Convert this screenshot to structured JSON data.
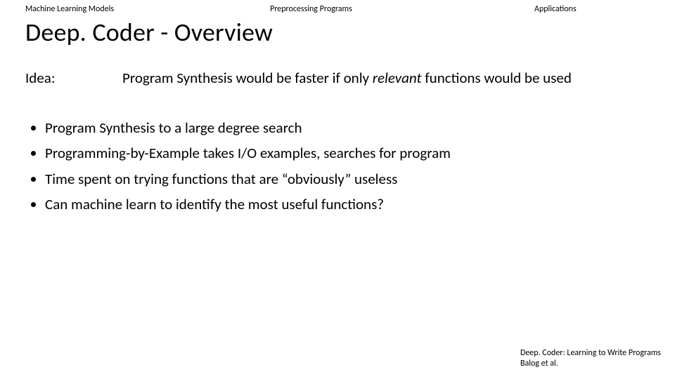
{
  "tabs": {
    "left": "Machine Learning Models",
    "mid": "Preprocessing Programs",
    "right": "Applications"
  },
  "title": "Deep. Coder - Overview",
  "idea": {
    "label": "Idea:",
    "pre": "Program Synthesis would be faster if only ",
    "em": "relevant",
    "post": " functions would be used"
  },
  "bullets": [
    "Program Synthesis to a large degree search",
    "Programming-by-Example takes I/O examples, searches for program",
    "Time spent on trying functions that are “obviously” useless",
    "Can machine learn to identify the most useful functions?"
  ],
  "footer": {
    "line1": "Deep. Coder: Learning to Write Programs",
    "line2": "Balog et al."
  }
}
